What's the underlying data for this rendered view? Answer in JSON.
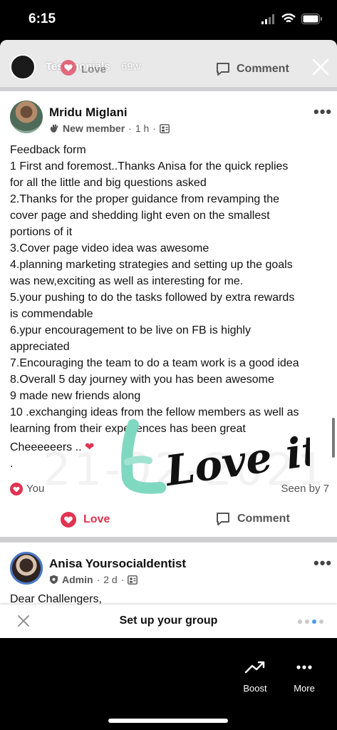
{
  "status_bar": {
    "time": "6:15"
  },
  "story_bar": {
    "group_name": "Testimonials",
    "age": "69w",
    "love_label": "Love",
    "comment_label": "Comment"
  },
  "post": {
    "author": "Mridu Miglani",
    "badge": "New member",
    "time": "1 h",
    "body_lines": [
      "Feedback form",
      "1 First and foremost..Thanks Anisa for the quick replies",
      "for all the little and big questions asked",
      "2.Thanks for the proper guidance from revamping the",
      "cover page and shedding light even on the smallest",
      "portions of it",
      "3.Cover page video idea was awesome",
      "4.planning marketing strategies and setting up the goals",
      "was new,exciting as well as interesting for me.",
      "5.your pushing to do the tasks followed by extra rewards",
      "is commendable",
      "6.ypur encouragement to be live on FB is highly",
      "appreciated",
      "7.Encouraging the team to do a team work is a good idea",
      "8.Overall 5 day journey with you has been awesome",
      "9 made new friends along",
      "10 .exchanging ideas from the fellow members as well as",
      "learning from their experiences has been great"
    ],
    "closing_line": "Cheeeeeers ..",
    "closing_dot": ".",
    "reaction_label": "You",
    "seen_label": "Seen by 7",
    "love_action": "Love",
    "comment_action": "Comment",
    "watermark_text": "21-02-2021",
    "sticker_text": "Love it!!"
  },
  "post2": {
    "author": "Anisa Yoursocialdentist",
    "badge": "Admin",
    "time": "2 d",
    "preview": "Dear Challengers,"
  },
  "setup_bar": {
    "title": "Set up your group"
  },
  "bottom_tools": [
    {
      "label": "Boost",
      "icon": "trending-up-icon"
    },
    {
      "label": "More",
      "icon": "more-dots-icon"
    }
  ],
  "colors": {
    "love_red": "#e0334f",
    "sticker_teal": "#7fd8c0",
    "dots_active": "#4b9ce8"
  }
}
